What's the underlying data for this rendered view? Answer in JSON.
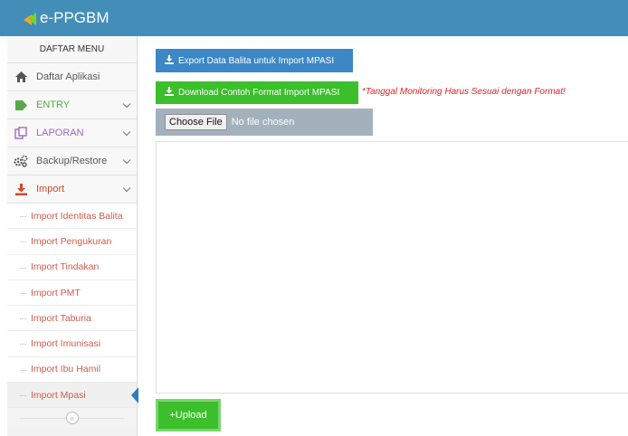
{
  "app": {
    "brand": "e-PPGBM"
  },
  "sidebar": {
    "header": "DAFTAR MENU",
    "items": [
      {
        "label": "Daftar Aplikasi",
        "icon": "home-icon"
      },
      {
        "label": "ENTRY",
        "icon": "tag-icon",
        "color": "#59a84b"
      },
      {
        "label": "LAPORAN",
        "icon": "copy-icon",
        "color": "#a069c3"
      },
      {
        "label": "Backup/Restore",
        "icon": "gears-icon"
      },
      {
        "label": "Import",
        "icon": "download-icon",
        "color": "#d5482b"
      }
    ],
    "submenu": [
      "Import Identitas Balita",
      "Import Pengukuran",
      "Import Tindakan",
      "Import PMT",
      "Import Taburia",
      "Import Imunisasi",
      "Import Ibu Hamil",
      "Import Mpasi"
    ],
    "active": "Import Mpasi"
  },
  "main": {
    "export_button": "Export Data Balita untuk Import MPASI",
    "download_button": "Download Contoh Format Import MPASI",
    "note": "*Tanggal Monitoring Harus Sesuai dengan Format!",
    "choose_file": "Choose File",
    "no_file": "No file chosen",
    "upload_button": "Upload",
    "upload_icon": "+"
  },
  "colors": {
    "topbar": "#438eb9",
    "blue": "#3c87c6",
    "green": "#3bbf2a",
    "note": "#e3232a"
  }
}
